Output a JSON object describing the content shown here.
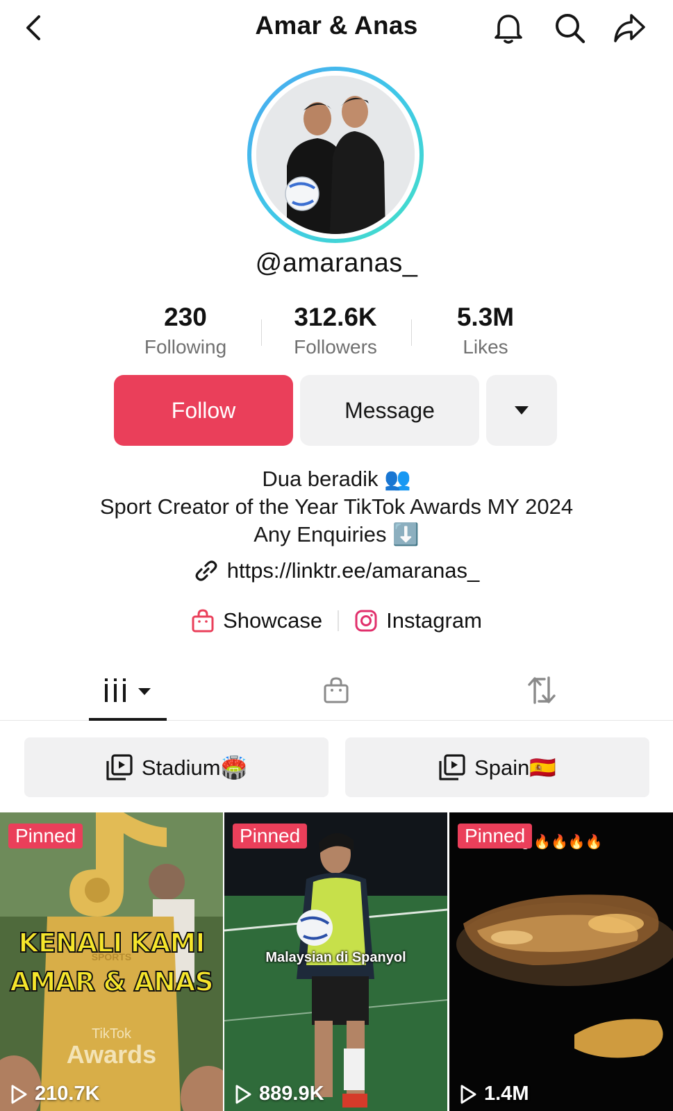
{
  "header": {
    "title": "Amar & Anas",
    "icons": [
      "back-icon",
      "bell-icon",
      "search-icon",
      "share-icon"
    ]
  },
  "profile": {
    "username": "@amaranas_",
    "stats": [
      {
        "value": "230",
        "label": "Following"
      },
      {
        "value": "312.6K",
        "label": "Followers"
      },
      {
        "value": "5.3M",
        "label": "Likes"
      }
    ],
    "follow_label": "Follow",
    "message_label": "Message",
    "bio_lines": [
      "Dua beradik 👥",
      "Sport Creator of the Year TikTok Awards MY 2024",
      "Any Enquiries ⬇️"
    ],
    "link": "https://linktr.ee/amaranas_",
    "showcase_label": "Showcase",
    "instagram_label": "Instagram"
  },
  "playlists": [
    {
      "label": "Stadium🏟️"
    },
    {
      "label": "Spain🇪🇸"
    }
  ],
  "videos": [
    {
      "badge": "Pinned",
      "views": "210.7K",
      "overlay_line1": "KENALI KAMI",
      "overlay_line2": "AMAR & ANAS",
      "award_label": "TikTok",
      "award_sub": "Awards",
      "sports_label": "SPORTS"
    },
    {
      "badge": "Pinned",
      "views": "889.9K",
      "caption": "Malaysian di Spanyol"
    },
    {
      "badge": "Pinned",
      "views": "1.4M",
      "caption": "ang 🔥🔥🔥🔥"
    }
  ],
  "colors": {
    "accent": "#ea3f5a",
    "button_grey": "#f1f1f2",
    "secondary_text": "#707070",
    "ring_start": "#4aa8f0",
    "ring_end": "#44e0c6"
  }
}
